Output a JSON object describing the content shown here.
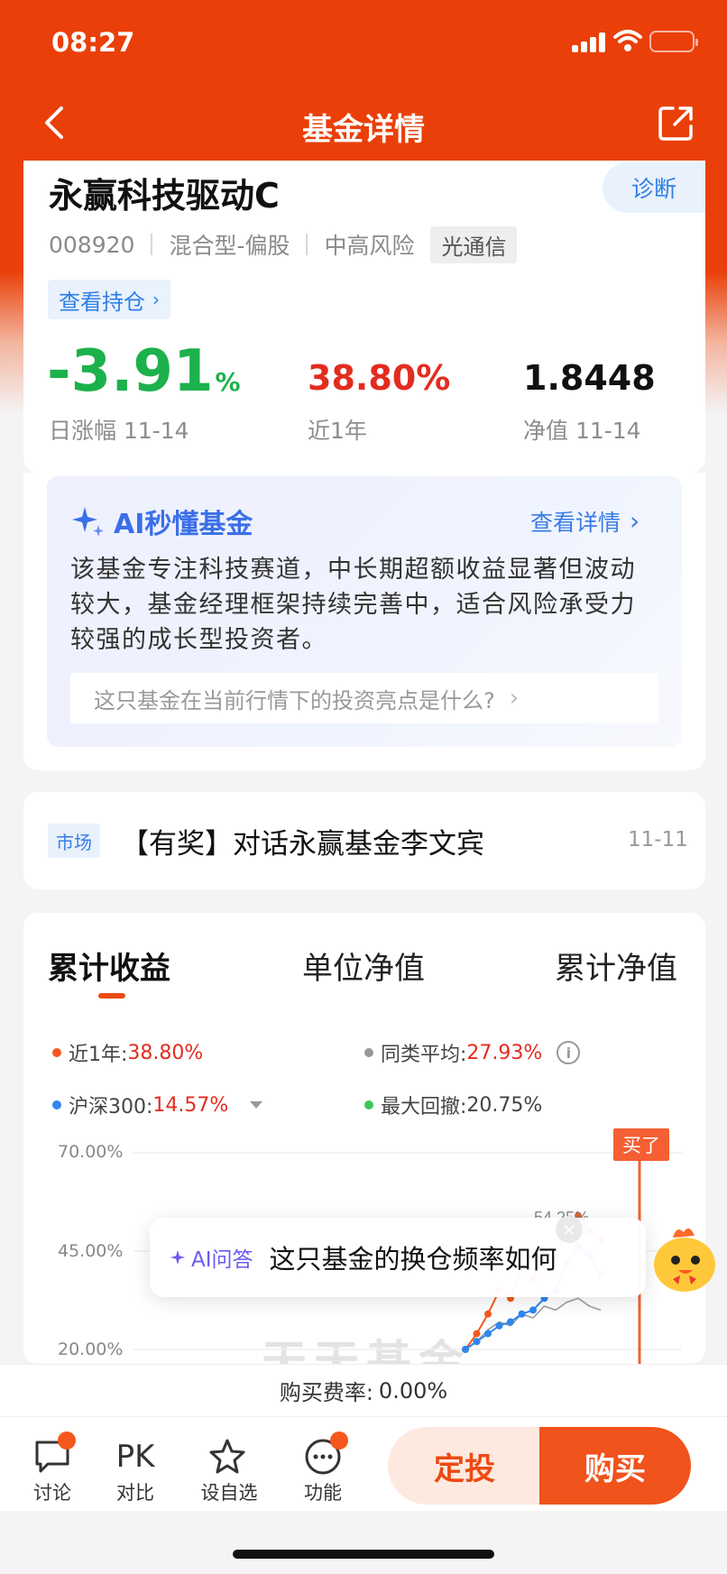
{
  "status_bar": {
    "time": "08:27"
  },
  "nav": {
    "title": "基金详情"
  },
  "fund": {
    "name": "永赢科技驱动C",
    "code": "008920",
    "type": "混合型-偏股",
    "risk": "中高风险",
    "theme_tag": "光通信",
    "diagnose_label": "诊断",
    "holdings_link": "查看持仓",
    "daily_change": "-3.91",
    "daily_change_unit": "%",
    "daily_change_label": "日涨幅 11-14",
    "one_year_return": "38.80%",
    "one_year_label": "近1年",
    "nav_value": "1.8448",
    "nav_label": "净值 11-14"
  },
  "ai_summary": {
    "title": "AI秒懂基金",
    "more_link": "查看详情",
    "text": "该基金专注科技赛道，中长期超额收益显著但波动较大，基金经理框架持续完善中，适合风险承受力较强的成长型投资者。",
    "question": "这只基金在当前行情下的投资亮点是什么?"
  },
  "news": {
    "tag": "市场",
    "title": "【有奖】对话永赢基金李文宾",
    "date": "11-11"
  },
  "chart_tabs": [
    "累计收益",
    "单位净值",
    "累计净值"
  ],
  "legend": {
    "fund_label": "近1年:",
    "fund_value": "38.80%",
    "peer_label": "同类平均:",
    "peer_value": "27.93%",
    "index_label": "沪深300:",
    "index_value": "14.57%",
    "drawdown_label": "最大回撤:",
    "drawdown_value": "20.75%",
    "colors": {
      "fund": "#f4581e",
      "peer": "#999999",
      "index": "#2f86f0",
      "drawdown": "#3fc65a"
    }
  },
  "chart_data": {
    "type": "line",
    "y_ticks": [
      "70.00%",
      "45.00%",
      "20.00%"
    ],
    "ylim": [
      20,
      70
    ],
    "marker_label": "买了",
    "peak_label": "54.25%",
    "watermark": "天天基金",
    "series": [
      {
        "name": "近1年",
        "values": [
          20,
          24,
          29,
          35,
          33,
          41,
          38,
          45,
          43,
          52,
          54,
          50,
          48
        ]
      },
      {
        "name": "同类平均",
        "values": [
          20,
          22,
          25,
          27,
          26,
          29,
          28,
          31,
          30,
          32,
          33,
          31,
          30
        ]
      },
      {
        "name": "沪深300",
        "values": [
          20,
          22,
          24,
          26,
          27,
          29,
          30,
          33,
          35,
          42,
          46,
          44,
          39
        ]
      }
    ]
  },
  "ai_qa": {
    "label": "AI问答",
    "question": "这只基金的换仓频率如何"
  },
  "fee": {
    "label": "购买费率:",
    "value": "0.00%"
  },
  "bottom_nav": {
    "discuss": "讨论",
    "compare_icon": "PK",
    "compare": "对比",
    "watchlist": "设自选",
    "functions": "功能",
    "auto_invest": "定投",
    "buy": "购买"
  }
}
